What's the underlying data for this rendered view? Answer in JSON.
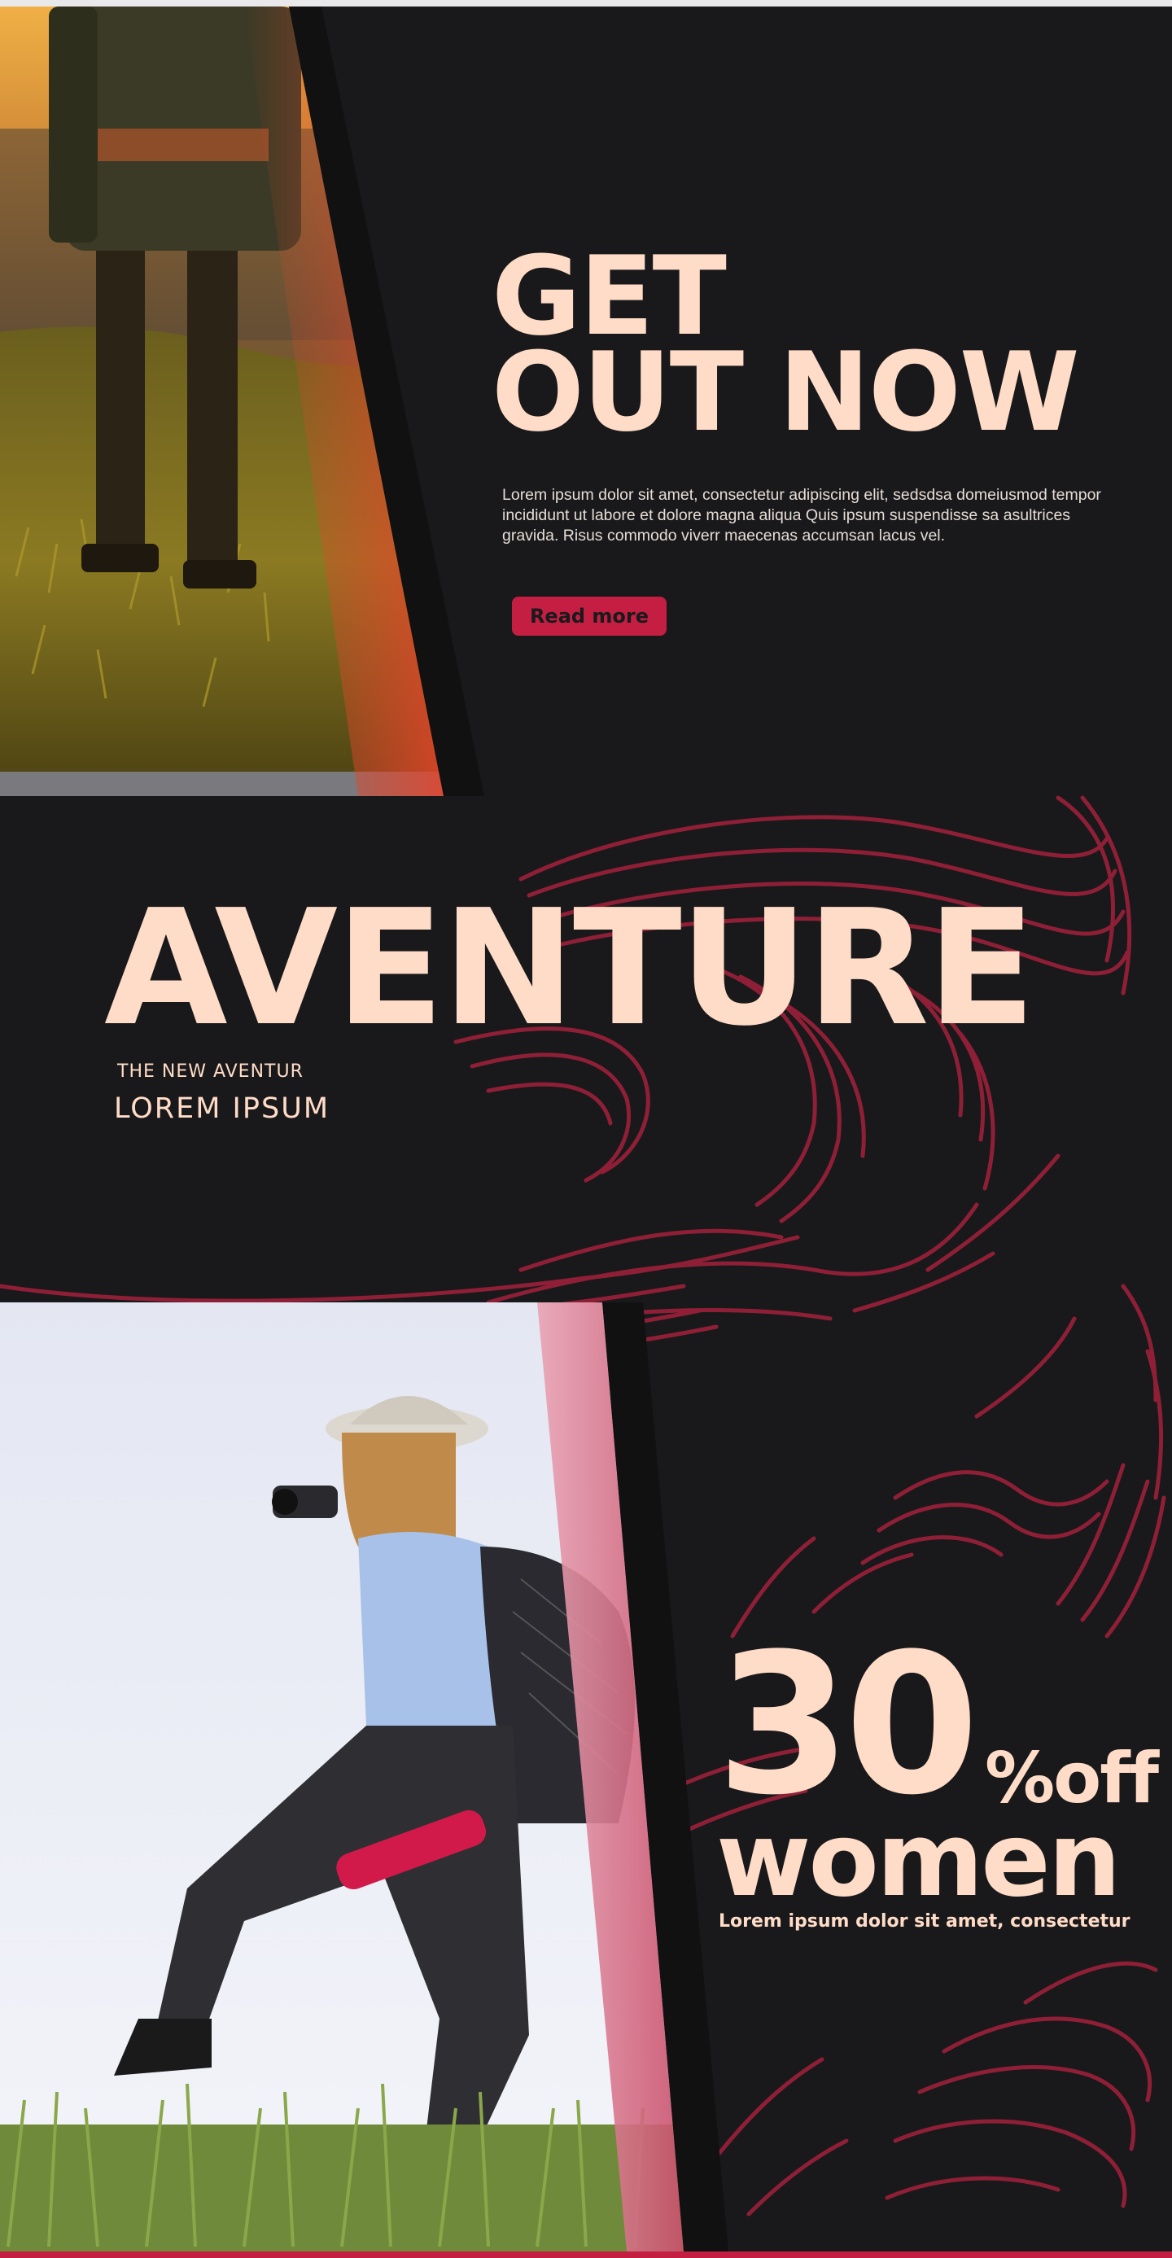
{
  "hero": {
    "headline_line1": "GET",
    "headline_line2": "OUT NOW",
    "body": "Lorem ipsum dolor sit amet, consectetur adipiscing elit, sedsdsa domeiusmod tempor incididunt ut labore et dolore magna aliqua Quis ipsum suspendisse sa asultrices gravida. Risus commodo viverr maecenas accumsan lacus vel.",
    "button_label": "Read more"
  },
  "aventure": {
    "title": "AVENTURE",
    "subtitle_small": "THE NEW AVENTUR",
    "subtitle_large": "LOREM IPSUM"
  },
  "promo": {
    "number": "30",
    "percent_off": "%off",
    "audience": "women",
    "tagline": "Lorem ipsum dolor sit amet, consectetur"
  },
  "colors": {
    "background": "#19191b",
    "cream": "#ffdcc7",
    "accent_red": "#c41f42",
    "topo_line": "#8f1f36"
  },
  "icons": {
    "topographic_pattern": "topographic-lines"
  }
}
